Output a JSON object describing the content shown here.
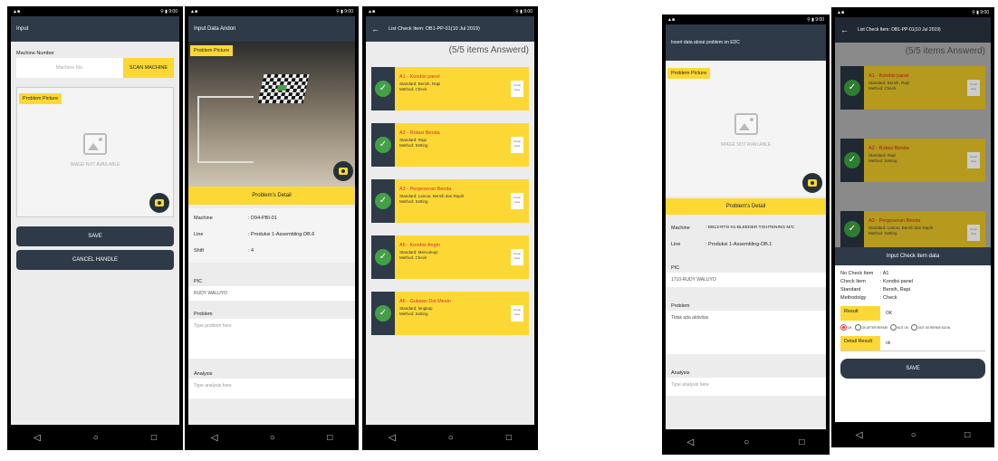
{
  "status": {
    "left": "▲■",
    "right": "⚲ ▮ 9:00"
  },
  "nav": {
    "back": "◁",
    "home": "○",
    "recent": "□"
  },
  "screen1": {
    "title": "Input",
    "machine_number_label": "Machine Number",
    "machine_placeholder": "Machine No.",
    "scan_button": "SCAN MACHINE",
    "problem_picture_label": "Problem Picture",
    "image_na": "IMAGE NOT AVAILABLE",
    "save_button": "SAVE",
    "cancel_button": "CANCEL HANDLE"
  },
  "screen2": {
    "title": "Input Data Andon",
    "problem_picture_label": "Problem Picture",
    "problems_detail": "Problem's Detail",
    "details": [
      {
        "k": "Machine",
        "v": ": D94-PBI-01"
      },
      {
        "k": "Line",
        "v": ": Produksi 1-Assembling-DB.6"
      },
      {
        "k": "Shift",
        "v": ": 4"
      }
    ],
    "pic_label": "PIC",
    "pic_value": "RUDY WALUYO",
    "problem_label": "Problem",
    "problem_placeholder": "Type problem here",
    "analysis_label": "Analysis",
    "analysis_placeholder": "Type analysis here"
  },
  "screen3": {
    "title": "List Check Item: DB1-PP-01(10 Jul 2019)",
    "answered": "(5/5 items Answerd)",
    "items": [
      {
        "title": "A1 - Kondisi panel",
        "standard": "Standard: Bersih, Rapi",
        "method": "Method: Check"
      },
      {
        "title": "A2 - Rotasi Benda",
        "standard": "Standard: Rapi",
        "method": "Method: Setting"
      },
      {
        "title": "A3 - Pergeseran Benda",
        "standard": "Standard: Lancar, Bersih dan Rapih",
        "method": "Method: Setting"
      },
      {
        "title": "A5 - Kondisi Angin",
        "standard": "Standard: Mencukupi",
        "method": "Method: Check"
      },
      {
        "title": "A6 - Gulatan Dst Mesin",
        "standard": "Standard: lengkap",
        "method": "Method: Setting"
      }
    ],
    "detail_btn": "Detail Data"
  },
  "screen4": {
    "title": "Insert data about problem on EDC",
    "problem_picture_label": "Problem Picture",
    "image_na": "IMAGE NOT AVAILABLE",
    "problems_detail": "Problem's Detail",
    "details": [
      {
        "k": "Machine",
        "v": ": DB13-RTG-01-BLEEDER TIGHTENING M/C"
      },
      {
        "k": "Line",
        "v": ": Produksi 1-Assembling-DB.1"
      }
    ],
    "pic_label": "PIC",
    "pic_value": "1710-RUDY WALUYO",
    "problem_label": "Problem",
    "problem_value": "Tidak ada aktivitas",
    "analysis_label": "Analysis",
    "analysis_placeholder": "Type analysis here"
  },
  "screen5": {
    "title": "List Check Item: DB1-PP-01(10 Jul 2019)",
    "answered": "(5/5 items Answerd)",
    "items": [
      {
        "title": "A1 - Kondisi panel",
        "standard": "Standard: Bersih, Rapi",
        "method": "Method: Check"
      },
      {
        "title": "A2 - Rotasi Benda",
        "standard": "Standard: Rapi",
        "method": "Method: Setting"
      },
      {
        "title": "A3 - Pergeseran Benda",
        "standard": "Standard: Lancar, Bersih dan Rapih",
        "method": "Method: Setting"
      }
    ],
    "detail_btn": "Detail Data",
    "dialog": {
      "title": "Input Check item data",
      "rows": [
        {
          "k": "No Check Item",
          "v": ": A1"
        },
        {
          "k": "Check Item",
          "v": ": Kondisi panel"
        },
        {
          "k": "Standard",
          "v": ": Bersih, Rapi"
        },
        {
          "k": "Methodolgy",
          "v": ": Check"
        }
      ],
      "result_label": "Result",
      "result_value": "OK",
      "options": [
        "OK",
        "OK AFTER REPAIR",
        "NOT OK",
        "NOT OK REPAIR SOON"
      ],
      "detail_result_label": "Detail Result",
      "detail_result_value": "ok",
      "save_button": "SAVE"
    }
  }
}
